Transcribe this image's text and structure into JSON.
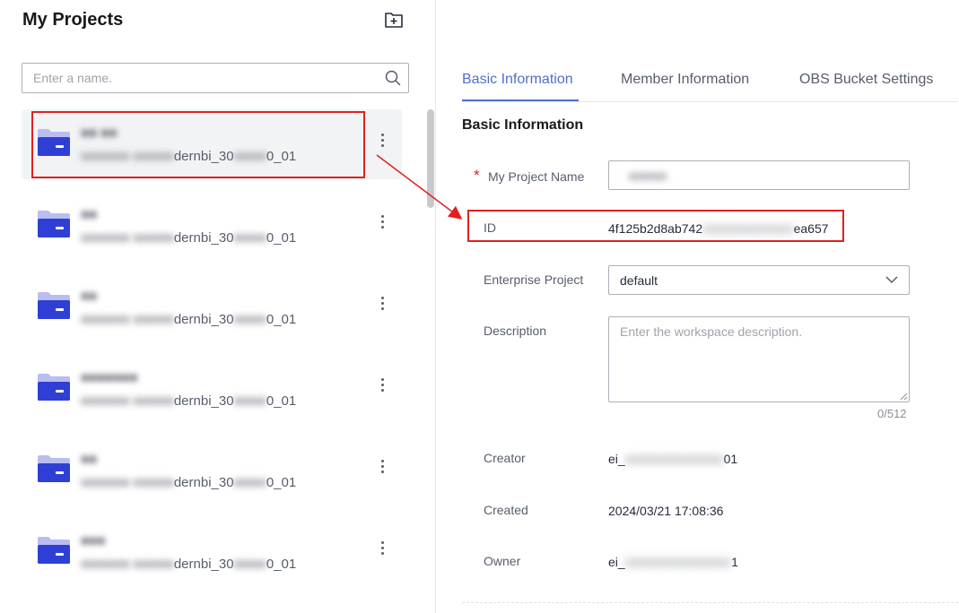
{
  "left": {
    "title": "My Projects",
    "search": {
      "placeholder": "Enter a name."
    },
    "projects": [
      {
        "name": "■■ ■■",
        "sub_hidden": "■■■■■■ ■■■■■",
        "sub_a": "dernbi_30",
        "sub_b_hidden": "■■■■",
        "sub_c": "0_01",
        "selected": true
      },
      {
        "name": "■■",
        "sub_hidden": "■■■■■■ ■■■■■",
        "sub_a": "dernbi_30",
        "sub_b_hidden": "■■■■",
        "sub_c": "0_01",
        "selected": false
      },
      {
        "name": "■■",
        "sub_hidden": "■■■■■■ ■■■■■",
        "sub_a": "dernbi_30",
        "sub_b_hidden": "■■■■",
        "sub_c": "0_01",
        "selected": false
      },
      {
        "name": "■■■■■■■",
        "sub_hidden": "■■■■■■ ■■■■■",
        "sub_a": "dernbi_30",
        "sub_b_hidden": "■■■■",
        "sub_c": "0_01",
        "selected": false
      },
      {
        "name": "■■",
        "sub_hidden": "■■■■■■ ■■■■■",
        "sub_a": "dernbi_30",
        "sub_b_hidden": "■■■■",
        "sub_c": "0_01",
        "selected": false
      },
      {
        "name": "■■■",
        "sub_hidden": "■■■■■■ ■■■■■",
        "sub_a": "dernbi_30",
        "sub_b_hidden": "■■■■",
        "sub_c": "0_01",
        "selected": false
      }
    ]
  },
  "tabs": [
    {
      "label": "Basic Information",
      "active": true
    },
    {
      "label": "Member Information",
      "active": false
    },
    {
      "label": "OBS Bucket Settings",
      "active": false
    }
  ],
  "section_title": "Basic Information",
  "form": {
    "project_name": {
      "label": "My Project Name",
      "required_mark": "*",
      "value_hidden": "■■■■■"
    },
    "id": {
      "label": "ID",
      "value_a": "4f125b2d8ab742",
      "value_hidden": "■■■■■■■■■■■■",
      "value_b": "ea657"
    },
    "enterprise_project": {
      "label": "Enterprise Project",
      "value": "default"
    },
    "description": {
      "label": "Description",
      "placeholder": "Enter the workspace description.",
      "counter": "0/512"
    },
    "creator": {
      "label": "Creator",
      "value_a": "ei_",
      "value_hidden": "■■■■■■■■■■■■■",
      "value_b": "01"
    },
    "created": {
      "label": "Created",
      "value": "2024/03/21 17:08:36"
    },
    "owner": {
      "label": "Owner",
      "value_a": "ei_",
      "value_hidden": "■■■■■■■■■■■■■■",
      "value_b": "1"
    }
  },
  "colors": {
    "accent": "#526ecc",
    "folder": "#2f3fd6",
    "folder_light": "#b9bdf2",
    "highlight": "#e02020"
  }
}
